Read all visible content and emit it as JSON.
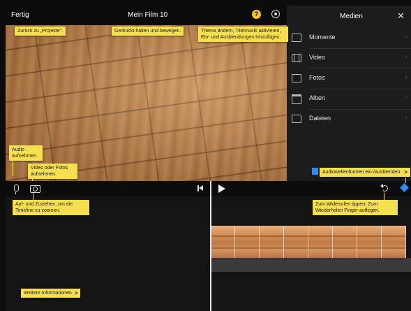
{
  "header": {
    "done_label": "Fertig",
    "project_title": "Mein Film 10",
    "help_glyph": "?",
    "help_icon": "help-icon",
    "settings_icon": "gear-icon"
  },
  "media_panel": {
    "title": "Medien",
    "close_glyph": "✕",
    "items": [
      {
        "label": "Momente",
        "icon": "moments-icon"
      },
      {
        "label": "Video",
        "icon": "film-icon"
      },
      {
        "label": "Fotos",
        "icon": "photo-icon"
      },
      {
        "label": "Alben",
        "icon": "album-icon"
      },
      {
        "label": "Dateien",
        "icon": "folder-icon"
      }
    ],
    "chevron": "›"
  },
  "tooltips": {
    "back": "Zurück zu „Projekte\".",
    "drag": "Gedrückt halten und bewegen.",
    "theme": "Thema ändern, Titelmusik aktivieren, Ein- und Ausblendungen hinzufügen.",
    "audio": "Audio aufnehmen.",
    "camera": "Video oder Fotos aufnehmen.",
    "zoom": "Auf- und Zuziehen, um die Timeline zu zoomen.",
    "undo": "Zum Widerrufen tippen. Zum Wiederholen Finger auflegen.",
    "waveform": "Audiowellenformen ein-/ausblenden.",
    "more_info": "Weitere Informationen",
    "arrow": ">"
  },
  "colors": {
    "tooltip": "#f6e04f",
    "help_badge": "#f5c518",
    "accent_blue": "#2d8cff"
  }
}
